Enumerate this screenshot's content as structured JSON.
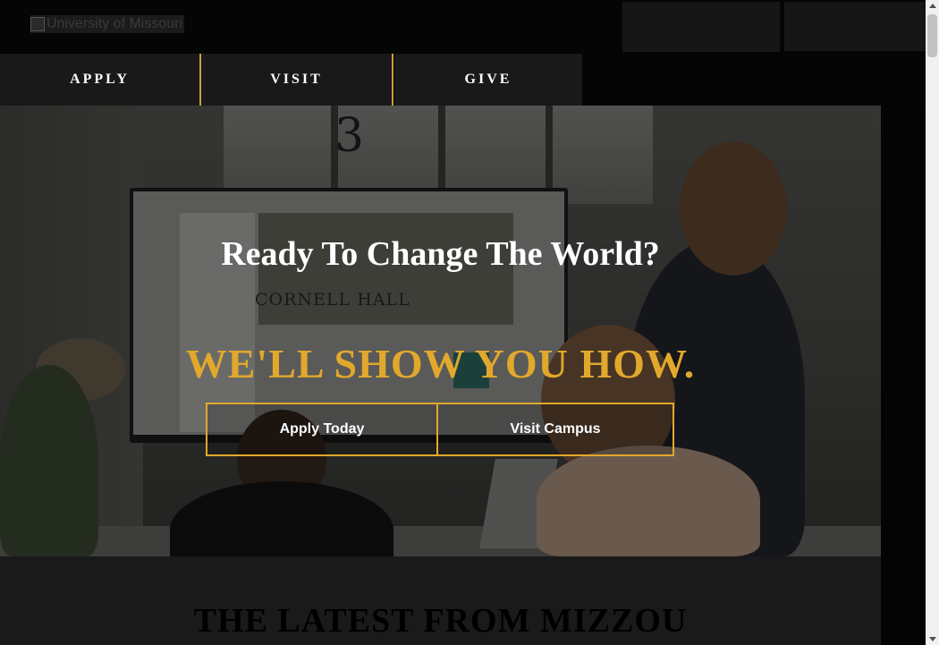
{
  "header": {
    "logo_alt": "University of Missouri"
  },
  "nav": {
    "items": [
      {
        "label": "APPLY"
      },
      {
        "label": "VISIT"
      },
      {
        "label": "GIVE"
      }
    ]
  },
  "hero": {
    "title": "Ready To Change The World?",
    "subtitle": "WE'LL SHOW YOU HOW.",
    "buttons": {
      "apply_label": "Apply Today",
      "visit_label": "Visit Campus"
    },
    "photo_text": {
      "room_number": "3",
      "screen_title": "CORNELL HALL"
    }
  },
  "latest": {
    "title": "THE LATEST FROM MIZZOU"
  },
  "colors": {
    "accent_gold": "#e2a82c",
    "background": "#050505"
  }
}
